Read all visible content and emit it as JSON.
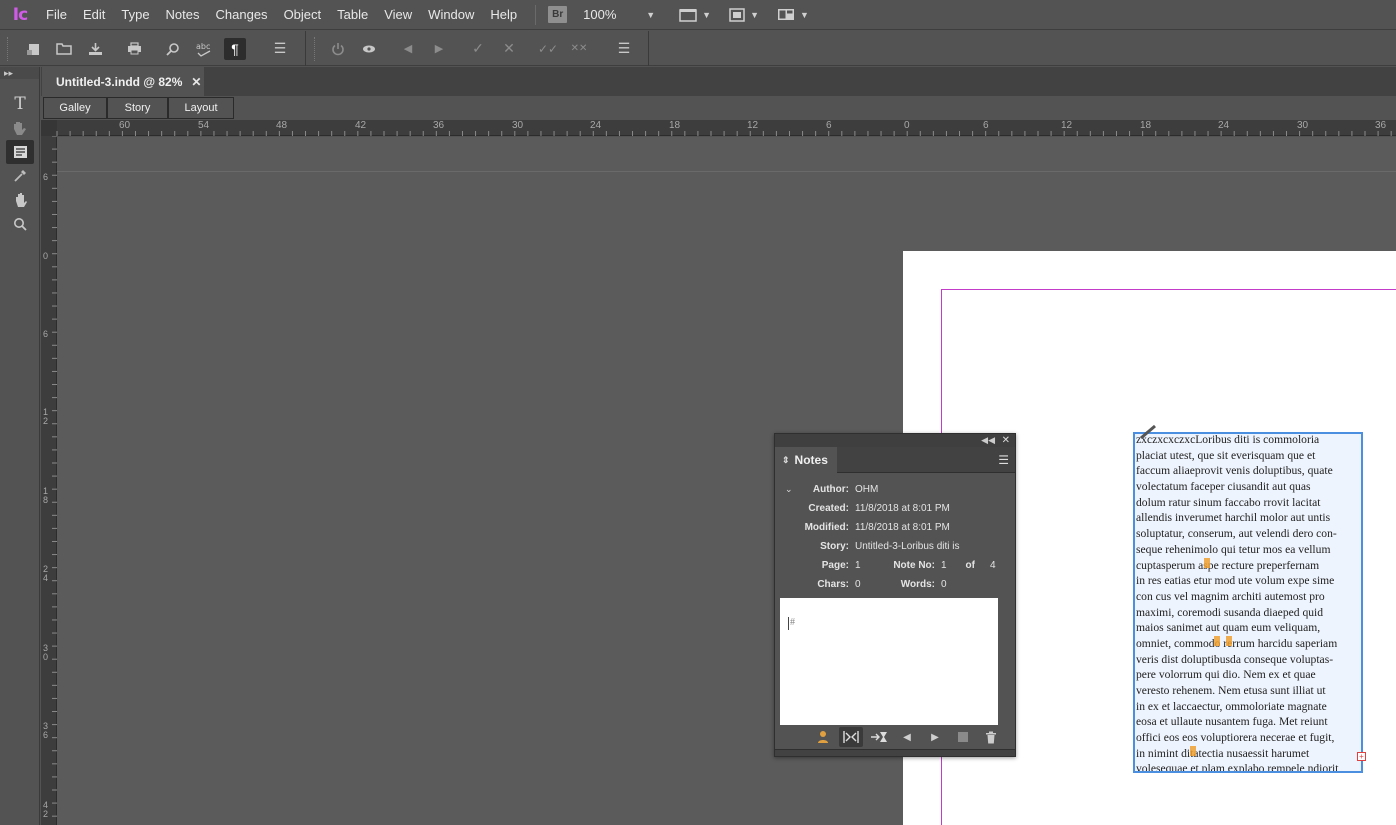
{
  "app": {
    "logo": "Ic",
    "menus": [
      "File",
      "Edit",
      "Type",
      "Notes",
      "Changes",
      "Object",
      "Table",
      "View",
      "Window",
      "Help"
    ],
    "bridge_label": "Br",
    "zoom": "100%"
  },
  "toolbar": {
    "icons_a": [
      "new-story-icon",
      "open-icon",
      "save-icon",
      "print-icon",
      "find-icon",
      "spellcheck-icon",
      "show-hidden-icon",
      "panel-menu-icon"
    ],
    "icons_b": [
      "track-changes-icon",
      "show-changes-icon",
      "prev-change-icon",
      "next-change-icon",
      "accept-change-icon",
      "reject-change-icon",
      "accept-all-icon",
      "reject-all-icon",
      "panel-menu-icon"
    ]
  },
  "document": {
    "tab_title": "Untitled-3.indd @ 82%"
  },
  "view_tabs": {
    "galley": "Galley",
    "story": "Story",
    "layout": "Layout"
  },
  "rulers": {
    "horizontal": [
      "60",
      "54",
      "48",
      "42",
      "36",
      "30",
      "24",
      "18",
      "12",
      "6",
      "0",
      "6",
      "12",
      "18",
      "24",
      "30",
      "36"
    ],
    "vertical": [
      "6",
      "0",
      "6",
      "1\n2",
      "1\n8",
      "2\n4",
      "3\n0",
      "3\n6",
      "4\n2"
    ]
  },
  "frame_text": {
    "lines": [
      "zxczxcxczxcLoribus diti is commoloria",
      "placiat utest, que sit everisquam que et",
      "faccum aliaeprovit venis doluptibus, quate",
      "volectatum faceper ciusandit aut quas",
      "dolum ratur sinum faccabo rrovit lacitat",
      "allendis inverumet harchil molor aut untis",
      "soluptatur, conserum, aut velendi dero con-",
      "seque rehenimolo qui tetur mos ea vellum",
      "cuptasperum aspe recture preperfernam",
      "in res eatias etur mod ute volum expe sime",
      "con cus vel magnim architi autemost pro",
      "maximi, coremodi susanda diaeped quid",
      "maios sanimet aut quam eum veliquam,",
      "omniet, commodo rerrum harcidu saperiam",
      "veris dist doluptibusda conseque voluptas-",
      "pere volorrum qui dio. Nem ex et quae",
      "veresto rehenem. Nem etusa sunt illiat ut",
      "in ex et laccaectur, ommoloriate magnate",
      "eosa et ullaute nusantem fuga. Met reiunt",
      "offici eos eos voluptiorera necerae et fugit,",
      "in nimint ditatectia nusaessit harumet",
      "volesequae et plam explabo rempele ndiorit"
    ]
  },
  "notes_panel": {
    "tab_label": "Notes",
    "author_label": "Author:",
    "author": "OHM",
    "created_label": "Created:",
    "created": "11/8/2018 at 8:01 PM",
    "modified_label": "Modified:",
    "modified": "11/8/2018 at 8:01 PM",
    "story_label": "Story:",
    "story": "Untitled-3-Loribus diti is",
    "page_label": "Page:",
    "page": "1",
    "note_no_label": "Note No:",
    "note_no": "1",
    "of_label": "of",
    "note_total": "4",
    "chars_label": "Chars:",
    "chars": "0",
    "words_label": "Words:",
    "words": "0",
    "note_text": "#"
  },
  "colors": {
    "accent_logo": "#d05be6",
    "frame_border": "#4a8fe0",
    "margin_guide": "#c33bc9"
  }
}
